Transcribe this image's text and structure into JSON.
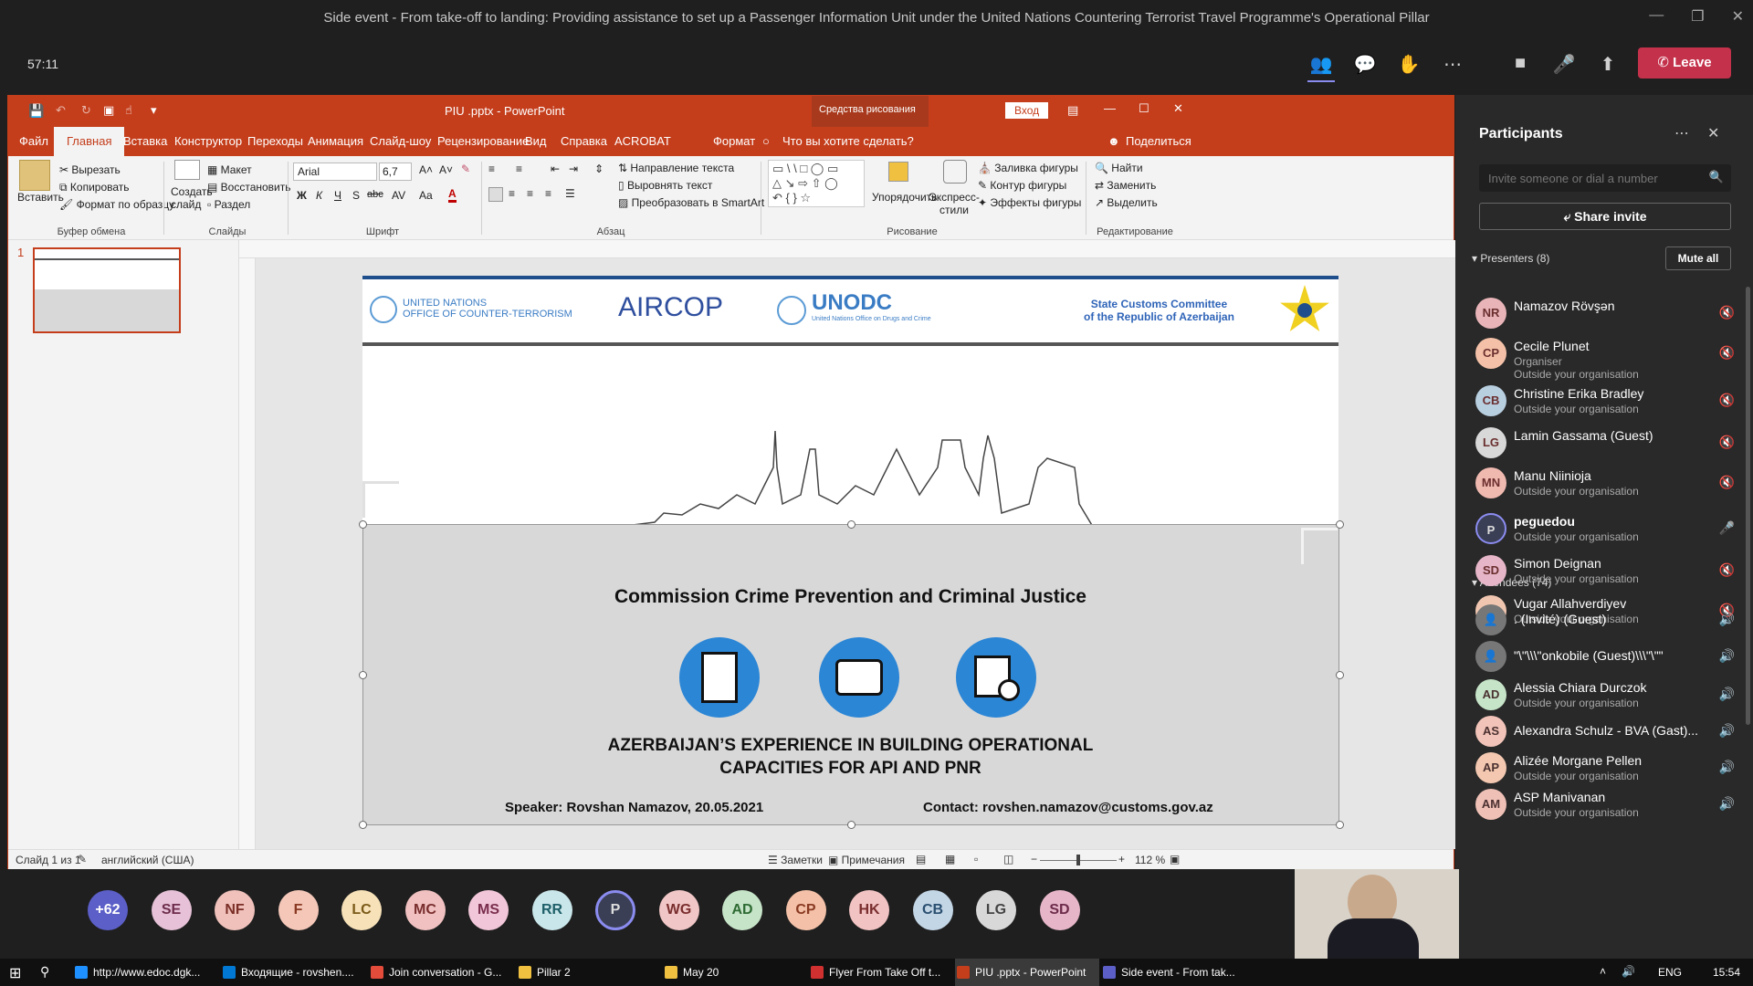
{
  "teams": {
    "title": "Side event - From take-off to landing: Providing assistance to set up a Passenger Information Unit under the United Nations Countering Terrorist Travel Programme's Operational Pillar",
    "timer": "57:11",
    "leave_label": "Leave"
  },
  "ppt": {
    "window_title": "PIU .pptx  -  PowerPoint",
    "drawing_tools": "Средства рисования",
    "signin": "Вход",
    "tabs": [
      "Файл",
      "Главная",
      "Вставка",
      "Конструктор",
      "Переходы",
      "Анимация",
      "Слайд-шоу",
      "Рецензирование",
      "Вид",
      "Справка",
      "ACROBAT",
      "Формат"
    ],
    "tell_me": "Что вы хотите сделать?",
    "share": "Поделиться",
    "ribbon": {
      "paste": "Вставить",
      "cut": "Вырезать",
      "copy": "Копировать",
      "format_painter": "Формат по образцу",
      "clipboard_group": "Буфер обмена",
      "new_slide": "Создать слайд",
      "layout": "Макет",
      "reset": "Восстановить",
      "section": "Раздел",
      "slides_group": "Слайды",
      "font_name": "Arial",
      "font_size": "6,7",
      "font_group": "Шрифт",
      "text_direction": "Направление текста",
      "align_text": "Выровнять текст",
      "smartart": "Преобразовать в SmartArt",
      "paragraph_group": "Абзац",
      "arrange": "Упорядочить",
      "quick_styles": "Экспресс-стили",
      "shape_fill": "Заливка фигуры",
      "shape_outline": "Контур фигуры",
      "shape_effects": "Эффекты фигуры",
      "drawing_group": "Рисование",
      "find": "Найти",
      "replace": "Заменить",
      "select": "Выделить",
      "editing_group": "Редактирование"
    },
    "slide_number": "1",
    "status": {
      "slide_of": "Слайд 1 из 1",
      "language": "английский (США)",
      "notes": "Заметки",
      "comments": "Примечания",
      "zoom": "112 %"
    },
    "slide": {
      "logo_uncct_1": "UNITED NATIONS",
      "logo_uncct_2": "OFFICE OF COUNTER-TERRORISM",
      "logo_aircop": "AIRCOP",
      "logo_unodc": "UNODC",
      "logo_unodc_sub": "United Nations Office on Drugs and Crime",
      "logo_customs_1": "State Customs Committee",
      "logo_customs_2": "of the Republic of Azerbaijan",
      "heading": "Commission Crime Prevention and Criminal Justice",
      "title_line1": "AZERBAIJAN’S EXPERIENCE IN BUILDING OPERATIONAL",
      "title_line2": "CAPACITIES FOR API AND PNR",
      "speaker": "Speaker: Rovshan Namazov, 20.05.2021",
      "contact": "Contact: rovshen.namazov@customs.gov.az"
    }
  },
  "panel": {
    "title": "Participants",
    "invite_placeholder": "Invite someone or dial a number",
    "share_invite": "Share invite",
    "presenters_label": "Presenters (8)",
    "mute_all": "Mute all",
    "attendees_label": "Attendees (74)",
    "presenters": [
      {
        "initials": "NR",
        "name": "Namazov Rövşən",
        "sub": "",
        "sub2": "",
        "color": "#e8b4b8"
      },
      {
        "initials": "CP",
        "name": "Cecile Plunet",
        "sub": "Organiser",
        "sub2": "Outside your organisation",
        "color": "#f4c1a8"
      },
      {
        "initials": "CB",
        "name": "Christine Erika Bradley",
        "sub": "Outside your organisation",
        "sub2": "",
        "color": "#b8cfe0"
      },
      {
        "initials": "LG",
        "name": "Lamin Gassama (Guest)",
        "sub": "",
        "sub2": "",
        "color": "#d8d8d8"
      },
      {
        "initials": "MN",
        "name": "Manu Niinioja",
        "sub": "Outside your organisation",
        "sub2": "",
        "color": "#f0b9b0"
      },
      {
        "initials": "P",
        "name": "peguedou",
        "sub": "Outside your organisation",
        "sub2": "",
        "color": "#3b3f55"
      },
      {
        "initials": "SD",
        "name": "Simon Deignan",
        "sub": "Outside your organisation",
        "sub2": "",
        "color": "#e6b6c8"
      },
      {
        "initials": "VA",
        "name": "Vugar Allahverdiyev",
        "sub": "Outside your organisation",
        "sub2": "",
        "color": "#f0c6b0"
      }
    ],
    "attendees": [
      {
        "initials": "",
        "name": ". (Invité) (Guest)",
        "sub": "",
        "color": "#777"
      },
      {
        "initials": "",
        "name": "\"\\\"\\\\\\\"onkobile (Guest)\\\\\\\"\\\"\"",
        "sub": "",
        "color": "#777"
      },
      {
        "initials": "AD",
        "name": "Alessia Chiara Durczok",
        "sub": "Outside your organisation",
        "color": "#c6e4c8"
      },
      {
        "initials": "AS",
        "name": "Alexandra Schulz - BVA (Gast)...",
        "sub": "",
        "color": "#f2c3b8"
      },
      {
        "initials": "AP",
        "name": "Alizée Morgane Pellen",
        "sub": "Outside your organisation",
        "color": "#f4c8b0"
      },
      {
        "initials": "AM",
        "name": "ASP Manivanan",
        "sub": "Outside your organisation",
        "color": "#efc0b6"
      }
    ]
  },
  "gallery": [
    {
      "initials": "+62",
      "color": "#5b5fc7",
      "text": "#fff"
    },
    {
      "initials": "SE",
      "color": "#e6c1d7",
      "text": "#6d2c4b"
    },
    {
      "initials": "NF",
      "color": "#f0c1bb",
      "text": "#7a2e26"
    },
    {
      "initials": "F",
      "color": "#f4c7b8",
      "text": "#8a3a22"
    },
    {
      "initials": "LC",
      "color": "#f6e1b8",
      "text": "#7a5a18"
    },
    {
      "initials": "MC",
      "color": "#f1c1c1",
      "text": "#7a2e2e"
    },
    {
      "initials": "MS",
      "color": "#f1c6d8",
      "text": "#7a2e4e"
    },
    {
      "initials": "RR",
      "color": "#c9e6ea",
      "text": "#1e5f68"
    },
    {
      "initials": "P",
      "color": "#3b3f55",
      "text": "#ddd"
    },
    {
      "initials": "WG",
      "color": "#f1c6c6",
      "text": "#7a2e2e"
    },
    {
      "initials": "AD",
      "color": "#c6e4c8",
      "text": "#2e6b33"
    },
    {
      "initials": "CP",
      "color": "#f4c1a8",
      "text": "#8a3a22"
    },
    {
      "initials": "HK",
      "color": "#f2c3c3",
      "text": "#7a2e2e"
    },
    {
      "initials": "CB",
      "color": "#c3d6e6",
      "text": "#2a4f70"
    },
    {
      "initials": "LG",
      "color": "#d8d8d8",
      "text": "#444"
    },
    {
      "initials": "SD",
      "color": "#e6b6c8",
      "text": "#6d2c4b"
    }
  ],
  "taskbar": {
    "items": [
      {
        "label": "http://www.edoc.dgk...",
        "color": "#1e90ff"
      },
      {
        "label": "Входящие - rovshen....",
        "color": "#0078d4"
      },
      {
        "label": "Join conversation - G...",
        "color": "#e34b3b"
      },
      {
        "label": "Pillar 2",
        "color": "#f0c040"
      },
      {
        "label": "May 20",
        "color": "#f0c040"
      },
      {
        "label": "Flyer From Take Off t...",
        "color": "#d03030"
      },
      {
        "label": "PIU .pptx - PowerPoint",
        "color": "#c43e1c"
      },
      {
        "label": "Side event - From tak...",
        "color": "#5b5fc7"
      }
    ],
    "lang": "ENG",
    "time": "15:54"
  }
}
